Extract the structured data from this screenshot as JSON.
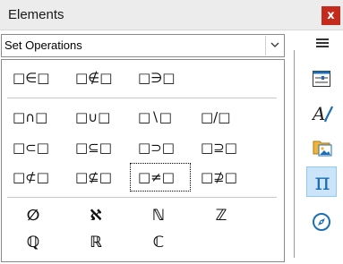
{
  "window": {
    "title": "Elements",
    "close": "x"
  },
  "category": {
    "selected": "Set Operations"
  },
  "groups": [
    {
      "items": [
        "□∈□",
        "□∉□",
        "□∋□"
      ]
    },
    {
      "items": [
        "□∩□",
        "□∪□",
        "□∖□",
        "□/□",
        "□⊂□",
        "□⊆□",
        "□⊃□",
        "□⊇□",
        "□⊄□",
        "□⊈□",
        "□≠□",
        "□⊉□"
      ]
    }
  ],
  "selected_item": "□≠□",
  "number_sets": [
    "∅",
    "ℵ",
    "ℕ",
    "ℤ",
    "ℚ",
    "ℝ",
    "ℂ"
  ],
  "sidebar": {
    "menu_icon": "hamburger-icon",
    "buttons": [
      {
        "icon": "properties-icon",
        "active": false
      },
      {
        "icon": "styles-icon",
        "active": false
      },
      {
        "icon": "gallery-icon",
        "active": false
      },
      {
        "icon": "pi-icon",
        "glyph": "π",
        "active": true
      },
      {
        "icon": "navigator-icon",
        "active": false
      }
    ]
  }
}
